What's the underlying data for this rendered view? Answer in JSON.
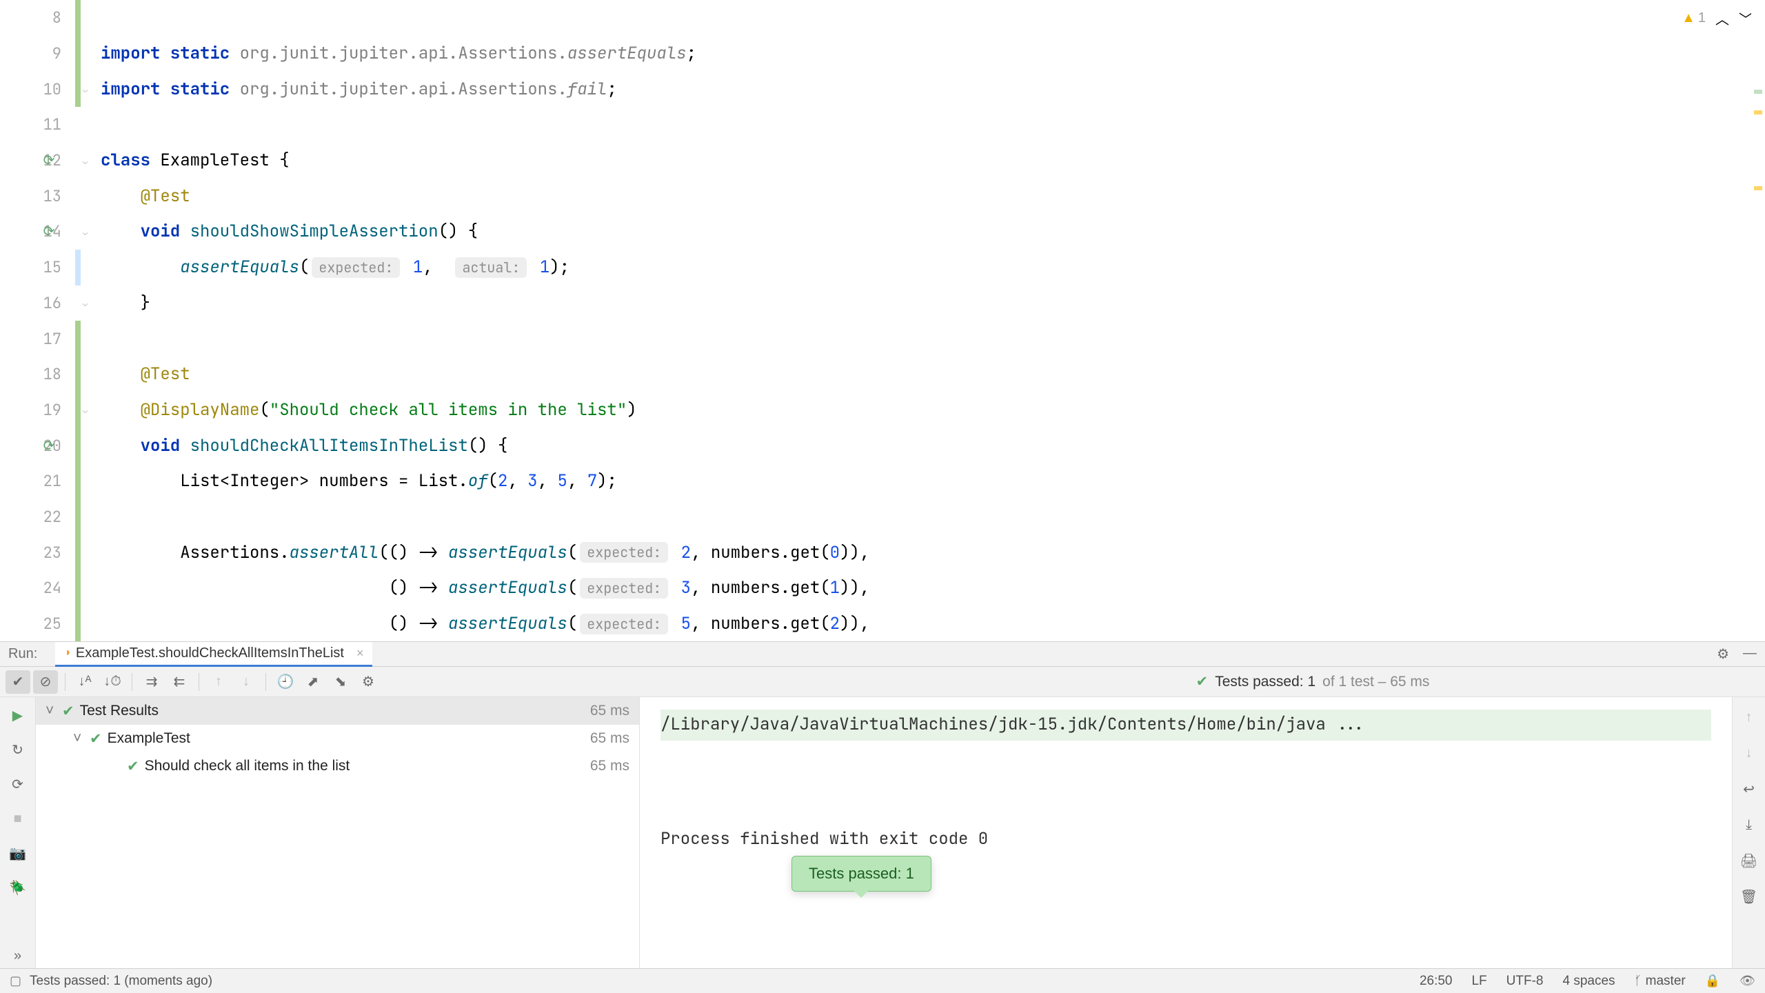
{
  "editor": {
    "warning_count": "1",
    "lines": [
      {
        "n": "8",
        "vcs": "green",
        "content": [
          {
            "t": "",
            "c": ""
          }
        ]
      },
      {
        "n": "9",
        "vcs": "green",
        "content": [
          {
            "t": "import ",
            "c": "kw"
          },
          {
            "t": "static ",
            "c": "kw"
          },
          {
            "t": "org.junit.jupiter.api.Assertions.",
            "c": "pkg"
          },
          {
            "t": "assertEquals",
            "c": "staticimp"
          },
          {
            "t": ";",
            "c": ""
          }
        ]
      },
      {
        "n": "10",
        "vcs": "green",
        "fold": true,
        "content": [
          {
            "t": "import ",
            "c": "kw"
          },
          {
            "t": "static ",
            "c": "kw"
          },
          {
            "t": "org.junit.jupiter.api.Assertions.",
            "c": "pkg"
          },
          {
            "t": "fail",
            "c": "staticimp"
          },
          {
            "t": ";",
            "c": ""
          }
        ]
      },
      {
        "n": "11",
        "content": [
          {
            "t": "",
            "c": ""
          }
        ]
      },
      {
        "n": "12",
        "run": true,
        "fold": true,
        "content": [
          {
            "t": "class ",
            "c": "kw"
          },
          {
            "t": "ExampleTest ",
            "c": "cls"
          },
          {
            "t": "{",
            "c": ""
          }
        ]
      },
      {
        "n": "13",
        "content": [
          {
            "t": "    ",
            "c": ""
          },
          {
            "t": "@Test",
            "c": "annot"
          }
        ]
      },
      {
        "n": "14",
        "run": true,
        "fold": true,
        "content": [
          {
            "t": "    ",
            "c": ""
          },
          {
            "t": "void ",
            "c": "kw"
          },
          {
            "t": "shouldShowSimpleAssertion",
            "c": "method"
          },
          {
            "t": "() {",
            "c": ""
          }
        ]
      },
      {
        "n": "15",
        "vcs": "blue",
        "content": [
          {
            "t": "        ",
            "c": ""
          },
          {
            "t": "assertEquals",
            "c": "staticm"
          },
          {
            "t": "(",
            "c": ""
          },
          {
            "hint": "expected:"
          },
          {
            "t": " ",
            "c": ""
          },
          {
            "t": "1",
            "c": "num"
          },
          {
            "t": ",  ",
            "c": ""
          },
          {
            "hint": "actual:"
          },
          {
            "t": " ",
            "c": ""
          },
          {
            "t": "1",
            "c": "num"
          },
          {
            "t": ");",
            "c": ""
          }
        ]
      },
      {
        "n": "16",
        "fold": true,
        "content": [
          {
            "t": "    }",
            "c": ""
          }
        ]
      },
      {
        "n": "17",
        "vcs": "green",
        "content": [
          {
            "t": "",
            "c": ""
          }
        ]
      },
      {
        "n": "18",
        "vcs": "green",
        "content": [
          {
            "t": "    ",
            "c": ""
          },
          {
            "t": "@Test",
            "c": "annot"
          }
        ]
      },
      {
        "n": "19",
        "vcs": "green",
        "fold": true,
        "content": [
          {
            "t": "    ",
            "c": ""
          },
          {
            "t": "@DisplayName",
            "c": "annot"
          },
          {
            "t": "(",
            "c": ""
          },
          {
            "t": "\"Should check all items in the list\"",
            "c": "string"
          },
          {
            "t": ")",
            "c": ""
          }
        ]
      },
      {
        "n": "20",
        "vcs": "green",
        "run": true,
        "content": [
          {
            "t": "    ",
            "c": ""
          },
          {
            "t": "void ",
            "c": "kw"
          },
          {
            "t": "shouldCheckAllItemsInTheList",
            "c": "method"
          },
          {
            "t": "() {",
            "c": ""
          }
        ]
      },
      {
        "n": "21",
        "vcs": "green",
        "content": [
          {
            "t": "        List<Integer> numbers = List.",
            "c": ""
          },
          {
            "t": "of",
            "c": "staticm"
          },
          {
            "t": "(",
            "c": ""
          },
          {
            "t": "2",
            "c": "num"
          },
          {
            "t": ", ",
            "c": ""
          },
          {
            "t": "3",
            "c": "num"
          },
          {
            "t": ", ",
            "c": ""
          },
          {
            "t": "5",
            "c": "num"
          },
          {
            "t": ", ",
            "c": ""
          },
          {
            "t": "7",
            "c": "num"
          },
          {
            "t": ");",
            "c": ""
          }
        ]
      },
      {
        "n": "22",
        "vcs": "green",
        "content": [
          {
            "t": "",
            "c": ""
          }
        ]
      },
      {
        "n": "23",
        "vcs": "green",
        "content": [
          {
            "t": "        Assertions.",
            "c": ""
          },
          {
            "t": "assertAll",
            "c": "staticm"
          },
          {
            "t": "(() -> ",
            "c": ""
          },
          {
            "t": "assertEquals",
            "c": "staticm"
          },
          {
            "t": "(",
            "c": ""
          },
          {
            "hint": "expected:"
          },
          {
            "t": " ",
            "c": ""
          },
          {
            "t": "2",
            "c": "num"
          },
          {
            "t": ", numbers.get(",
            "c": ""
          },
          {
            "t": "0",
            "c": "num"
          },
          {
            "t": ")),",
            "c": ""
          }
        ]
      },
      {
        "n": "24",
        "vcs": "green",
        "content": [
          {
            "t": "                             () -> ",
            "c": ""
          },
          {
            "t": "assertEquals",
            "c": "staticm"
          },
          {
            "t": "(",
            "c": ""
          },
          {
            "hint": "expected:"
          },
          {
            "t": " ",
            "c": ""
          },
          {
            "t": "3",
            "c": "num"
          },
          {
            "t": ", numbers.get(",
            "c": ""
          },
          {
            "t": "1",
            "c": "num"
          },
          {
            "t": ")),",
            "c": ""
          }
        ]
      },
      {
        "n": "25",
        "vcs": "green",
        "content": [
          {
            "t": "                             () -> ",
            "c": ""
          },
          {
            "t": "assertEquals",
            "c": "staticm"
          },
          {
            "t": "(",
            "c": ""
          },
          {
            "hint": "expected:"
          },
          {
            "t": " ",
            "c": ""
          },
          {
            "t": "5",
            "c": "num"
          },
          {
            "t": ", numbers.get(",
            "c": ""
          },
          {
            "t": "2",
            "c": "num"
          },
          {
            "t": ")),",
            "c": ""
          }
        ]
      }
    ]
  },
  "run": {
    "label": "Run:",
    "tab": "ExampleTest.shouldCheckAllItemsInTheList",
    "status_passed": "Tests passed: 1",
    "status_total": " of 1 test – 65 ms",
    "tree": [
      {
        "label": "Test Results",
        "time": "65 ms",
        "sel": true,
        "exp": true,
        "indent": 0
      },
      {
        "label": "ExampleTest",
        "time": "65 ms",
        "exp": true,
        "indent": 1
      },
      {
        "label": "Should check all items in the list",
        "time": "65 ms",
        "indent": 2
      }
    ],
    "console_cmd": "/Library/Java/JavaVirtualMachines/jdk-15.jdk/Contents/Home/bin/java ...",
    "console_exit": "Process finished with exit code 0",
    "popup": "Tests passed: 1"
  },
  "statusbar": {
    "msg": "Tests passed: 1 (moments ago)",
    "pos": "26:50",
    "sep": "LF",
    "enc": "UTF-8",
    "indent": "4 spaces",
    "branch": "master"
  }
}
